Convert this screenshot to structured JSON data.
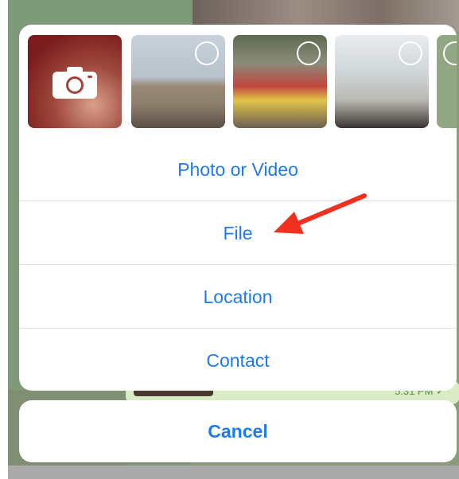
{
  "background": {
    "message_time": "5:31 PM ✓"
  },
  "attach_menu": {
    "media_tiles": [
      {
        "kind": "camera",
        "icon": "camera-icon"
      },
      {
        "kind": "photo",
        "selected": false
      },
      {
        "kind": "photo",
        "selected": false
      },
      {
        "kind": "photo",
        "selected": false
      },
      {
        "kind": "photo",
        "selected": false
      }
    ],
    "options": [
      {
        "label": "Photo or Video"
      },
      {
        "label": "File"
      },
      {
        "label": "Location"
      },
      {
        "label": "Contact"
      }
    ],
    "cancel_label": "Cancel"
  },
  "annotation": {
    "arrow_color": "#f0311f",
    "points_to": "File"
  },
  "colors": {
    "accent": "#1e7bf2",
    "sheet": "#ffffff"
  }
}
